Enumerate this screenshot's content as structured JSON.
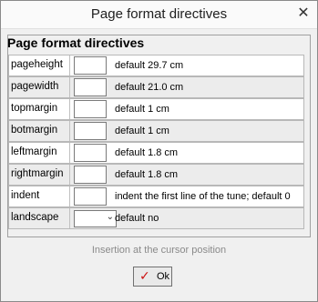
{
  "window": {
    "title": "Page format directives",
    "close_glyph": "✕"
  },
  "group": {
    "title": "Page format directives"
  },
  "rows": [
    {
      "label": "pageheight",
      "desc": "default 29.7 cm"
    },
    {
      "label": "pagewidth",
      "desc": "default 21.0 cm"
    },
    {
      "label": "topmargin",
      "desc": "default 1 cm"
    },
    {
      "label": "botmargin",
      "desc": "default 1 cm"
    },
    {
      "label": "leftmargin",
      "desc": "default 1.8 cm"
    },
    {
      "label": "rightmargin",
      "desc": "default 1.8 cm"
    },
    {
      "label": "indent",
      "desc": "indent the first line of the tune; default 0"
    },
    {
      "label": "landscape",
      "desc": "default no"
    }
  ],
  "landscape_select": {
    "value": "",
    "arrow_glyph": "⌄"
  },
  "hint": "Insertion at the cursor position",
  "ok_button": {
    "label": "Ok",
    "icon": "check-icon",
    "icon_glyph": "✓",
    "icon_color": "#cc1010"
  }
}
